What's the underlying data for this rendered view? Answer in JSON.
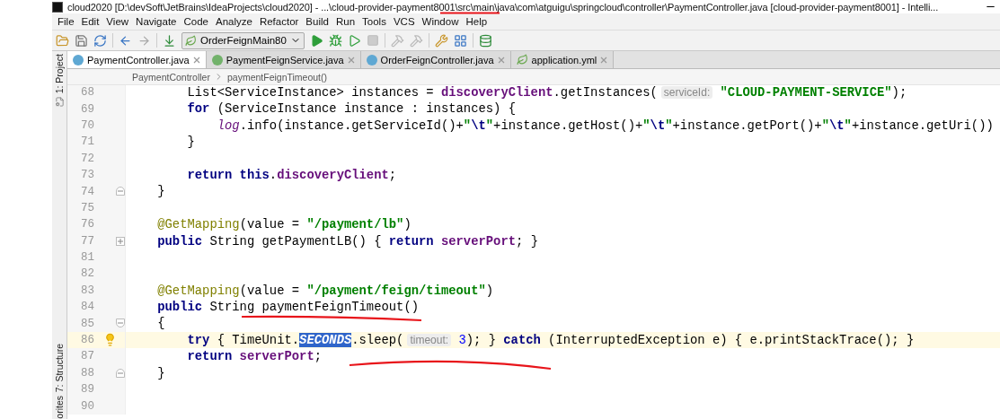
{
  "window": {
    "title": "cloud2020 [D:\\devSoft\\JetBrains\\IdeaProjects\\cloud2020] - ...\\cloud-provider-payment8001\\src\\main\\java\\com\\atguigu\\springcloud\\controller\\PaymentController.java [cloud-provider-payment8001] - Intelli..."
  },
  "menu": [
    "File",
    "Edit",
    "View",
    "Navigate",
    "Code",
    "Analyze",
    "Refactor",
    "Build",
    "Run",
    "Tools",
    "VCS",
    "Window",
    "Help"
  ],
  "toolbar": {
    "run_config": "OrderFeignMain80"
  },
  "side_tabs": [
    {
      "label": "1: Project"
    },
    {
      "label": "7: Structure"
    },
    {
      "label": "orites"
    }
  ],
  "tabs": [
    {
      "label": "PaymentController.java",
      "kind": "class",
      "selected": true
    },
    {
      "label": "PaymentFeignService.java",
      "kind": "interface",
      "selected": false
    },
    {
      "label": "OrderFeignController.java",
      "kind": "class",
      "selected": false
    },
    {
      "label": "application.yml",
      "kind": "yaml",
      "selected": false
    }
  ],
  "breadcrumb": [
    "PaymentController",
    "paymentFeignTimeout()"
  ],
  "code": [
    {
      "number": "68",
      "kind": "plain",
      "segments": [
        {
          "text": "        List<ServiceInstance> instances = ",
          "kind": "plain"
        },
        {
          "text": "discoveryClient",
          "kind": "field"
        },
        {
          "text": ".getInstances(",
          "kind": "plain"
        },
        {
          "text": "serviceId:",
          "kind": "hint"
        },
        {
          "text": " \"CLOUD-PAYMENT-SERVICE\"",
          "kind": "string"
        },
        {
          "text": ");",
          "kind": "plain"
        }
      ]
    },
    {
      "number": "69",
      "kind": "plain",
      "segments": [
        {
          "text": "        for",
          "kind": "keyword"
        },
        {
          "text": " (ServiceInstance instance : instances) {",
          "kind": "plain"
        }
      ]
    },
    {
      "number": "70",
      "kind": "plain",
      "segments": [
        {
          "text": "            log",
          "kind": "static"
        },
        {
          "text": ".info(instance.getServiceId()+",
          "kind": "plain"
        },
        {
          "text": "\"",
          "kind": "string"
        },
        {
          "text": "\\t",
          "kind": "escape"
        },
        {
          "text": "\"",
          "kind": "string"
        },
        {
          "text": "+instance.getHost()+",
          "kind": "plain"
        },
        {
          "text": "\"",
          "kind": "string"
        },
        {
          "text": "\\t",
          "kind": "escape"
        },
        {
          "text": "\"",
          "kind": "string"
        },
        {
          "text": "+instance.getPort()+",
          "kind": "plain"
        },
        {
          "text": "\"",
          "kind": "string"
        },
        {
          "text": "\\t",
          "kind": "escape"
        },
        {
          "text": "\"",
          "kind": "string"
        },
        {
          "text": "+instance.getUri())",
          "kind": "plain"
        }
      ]
    },
    {
      "number": "71",
      "kind": "plain",
      "segments": [
        {
          "text": "        }",
          "kind": "plain"
        }
      ]
    },
    {
      "number": "72",
      "kind": "plain"
    },
    {
      "number": "73",
      "kind": "plain",
      "segments": [
        {
          "text": "        return this",
          "kind": "keyword"
        },
        {
          "text": ".",
          "kind": "plain"
        },
        {
          "text": "discoveryClient",
          "kind": "field"
        },
        {
          "text": ";",
          "kind": "plain"
        }
      ]
    },
    {
      "number": "74",
      "kind": "fold_end",
      "segments": [
        {
          "text": "    }",
          "kind": "plain"
        }
      ]
    },
    {
      "number": "75",
      "kind": "plain"
    },
    {
      "number": "76",
      "kind": "plain",
      "segments": [
        {
          "text": "    @GetMapping",
          "kind": "annotation"
        },
        {
          "text": "(value = ",
          "kind": "plain"
        },
        {
          "text": "\"/payment/lb\"",
          "kind": "string"
        },
        {
          "text": ")",
          "kind": "plain"
        }
      ]
    },
    {
      "number": "77",
      "kind": "folded",
      "segments": [
        {
          "text": "    public",
          "kind": "keyword"
        },
        {
          "text": " String getPaymentLB() { ",
          "kind": "plain"
        },
        {
          "text": "return",
          "kind": "keyword"
        },
        {
          "text": " serverPort",
          "kind": "field"
        },
        {
          "text": "; }",
          "kind": "plain"
        }
      ]
    },
    {
      "number": "81",
      "kind": "plain"
    },
    {
      "number": "82",
      "kind": "plain"
    },
    {
      "number": "83",
      "kind": "plain",
      "segments": [
        {
          "text": "    @GetMapping",
          "kind": "annotation"
        },
        {
          "text": "(value = ",
          "kind": "plain"
        },
        {
          "text": "\"/payment/feign/timeout\"",
          "kind": "string"
        },
        {
          "text": ")",
          "kind": "plain"
        }
      ]
    },
    {
      "number": "84",
      "kind": "plain",
      "segments": [
        {
          "text": "    public",
          "kind": "keyword"
        },
        {
          "text": " String paymentFeignTimeout()",
          "kind": "plain"
        }
      ]
    },
    {
      "number": "85",
      "kind": "fold_start",
      "segments": [
        {
          "text": "    {",
          "kind": "plain"
        }
      ]
    },
    {
      "number": "86",
      "kind": "plain",
      "current": true,
      "segments": [
        {
          "text": "        try",
          "kind": "keyword"
        },
        {
          "text": " { TimeUnit.",
          "kind": "plain"
        },
        {
          "text": "SECONDS",
          "kind": "selected"
        },
        {
          "text": ".sleep(",
          "kind": "plain"
        },
        {
          "text": "timeout:",
          "kind": "hint"
        },
        {
          "text": " 3",
          "kind": "number"
        },
        {
          "text": "); } ",
          "kind": "plain"
        },
        {
          "text": "catch",
          "kind": "keyword"
        },
        {
          "text": " (InterruptedException e) { e.printStackTrace(); }",
          "kind": "plain"
        }
      ]
    },
    {
      "number": "87",
      "kind": "plain",
      "segments": [
        {
          "text": "        return",
          "kind": "keyword"
        },
        {
          "text": " serverPort",
          "kind": "field"
        },
        {
          "text": ";",
          "kind": "plain"
        }
      ]
    },
    {
      "number": "88",
      "kind": "fold_end",
      "segments": [
        {
          "text": "    }",
          "kind": "plain"
        }
      ]
    },
    {
      "number": "89",
      "kind": "plain"
    },
    {
      "number": "90",
      "kind": "plain"
    }
  ]
}
